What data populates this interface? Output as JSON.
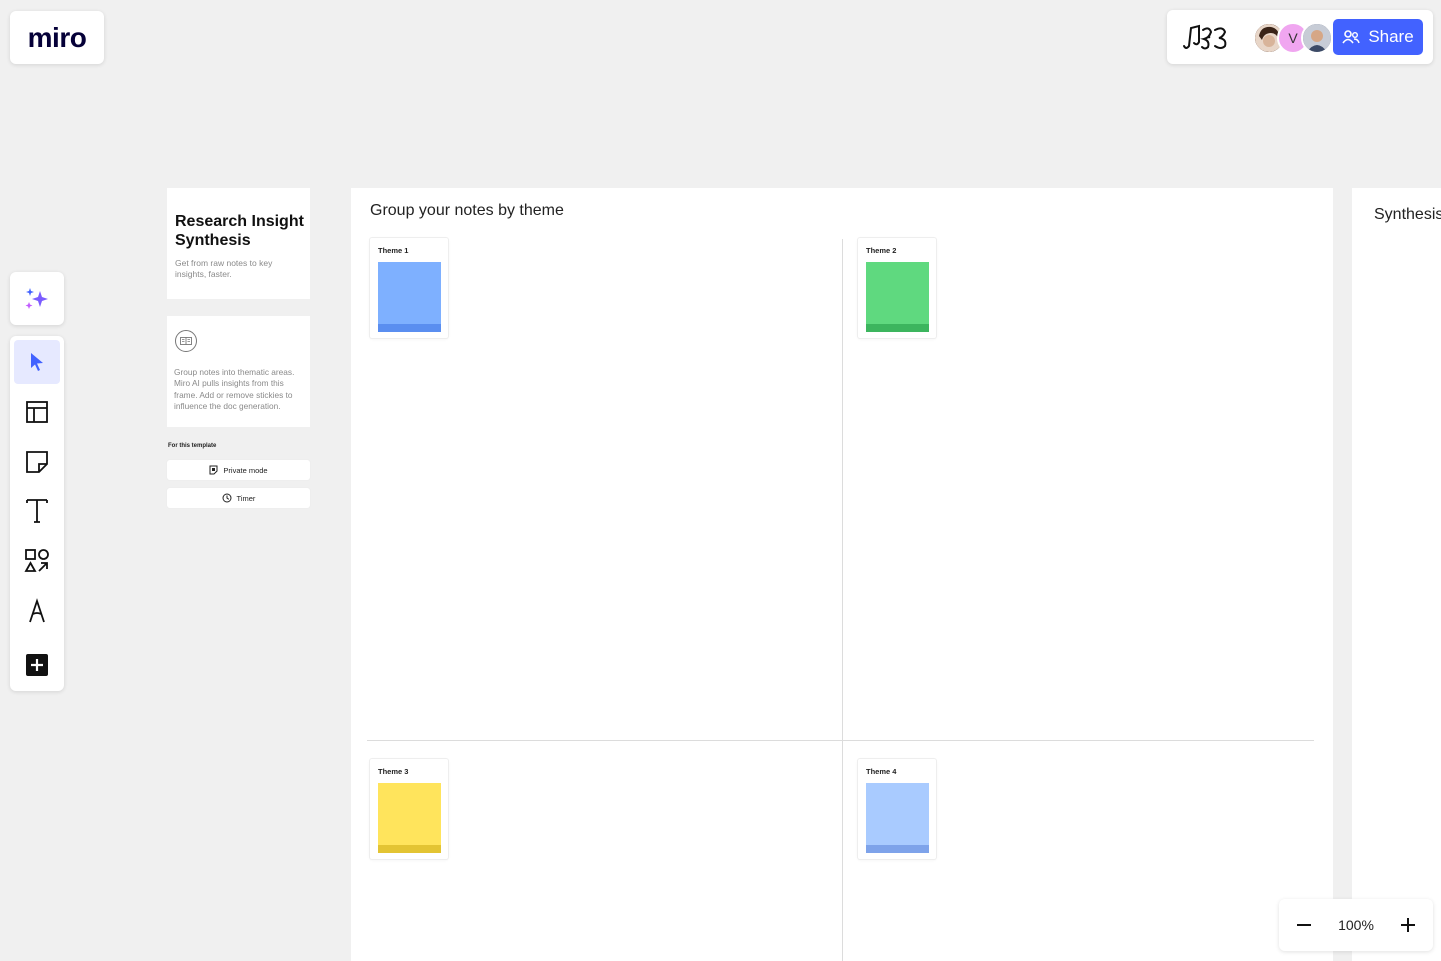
{
  "app": {
    "logo_text": "miro"
  },
  "header": {
    "share_label": "Share",
    "avatars": [
      {
        "name": "user-avatar-1",
        "initial": "",
        "color": "#6b4a3a"
      },
      {
        "name": "user-avatar-2",
        "initial": "V",
        "color": "#f0a6f0"
      },
      {
        "name": "user-avatar-3",
        "initial": "",
        "color": "#8a94a6"
      }
    ]
  },
  "toolbar": {
    "tools": [
      "ai-sparkles",
      "select",
      "templates",
      "sticky-note",
      "text",
      "shapes",
      "pen",
      "more"
    ]
  },
  "info_card": {
    "title": "Research Insight Synthesis",
    "subtitle": "Get from raw notes to key insights, faster."
  },
  "help_card": {
    "text": "Group notes into thematic areas. Miro AI pulls insights from this frame. Add or remove stickies to influence the doc generation."
  },
  "template_tools": {
    "heading": "For this template",
    "private_mode": "Private mode",
    "timer": "Timer"
  },
  "frame": {
    "title": "Group your notes by theme",
    "themes": [
      {
        "label": "Theme 1",
        "color": "#7eb0ff",
        "base": "#5a8ef0"
      },
      {
        "label": "Theme 2",
        "color": "#5fd97f",
        "base": "#3cb55e"
      },
      {
        "label": "Theme 3",
        "color": "#ffe45c",
        "base": "#e3c433"
      },
      {
        "label": "Theme 4",
        "color": "#a9cbff",
        "base": "#7ea3ea"
      }
    ]
  },
  "frame2": {
    "title": "Synthesis"
  },
  "zoom": {
    "level": "100%"
  },
  "colors": {
    "accent": "#4262ff",
    "canvas": "#f0f0f0"
  }
}
